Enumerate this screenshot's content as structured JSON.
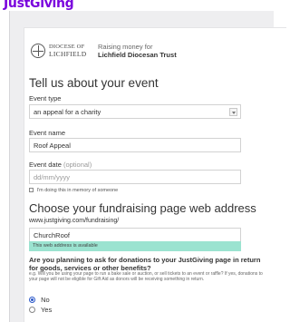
{
  "brand": {
    "logo_text": "JustGiving",
    "color": "#7a04dd"
  },
  "charity": {
    "org_line1": "DIOCESE OF",
    "org_line2": "LICHFIELD",
    "raising_text": "Raising money for",
    "name": "Lichfield Diocesan Trust"
  },
  "event_section": {
    "heading": "Tell us about your event",
    "event_type": {
      "label": "Event type",
      "value": "an appeal for a charity"
    },
    "event_name": {
      "label": "Event name",
      "value": "Roof Appeal"
    },
    "event_date": {
      "label": "Event date",
      "optional_note": "(optional)",
      "placeholder": "dd/mm/yyyy"
    },
    "memory_checkbox": {
      "label": "I'm doing this in memory of someone",
      "checked": false
    }
  },
  "address_section": {
    "heading": "Choose your fundraising page web address",
    "url_prefix": "www.justgiving.com/fundraising/",
    "url_value": "ChurchRoof",
    "availability_message": "This web address is available",
    "availability_color": "#9be3d0"
  },
  "donations_question": {
    "question": "Are you planning to ask for donations to your JustGiving page in return for goods, services or other benefits?",
    "help": "e.g. Will you be using your page to run a bake sale or auction, or sell tickets to an event or raffle? If yes, donations to your page will not be eligible for Gift Aid as donors will be receiving something in return.",
    "options": [
      {
        "label": "No",
        "selected": true
      },
      {
        "label": "Yes",
        "selected": false
      }
    ]
  }
}
